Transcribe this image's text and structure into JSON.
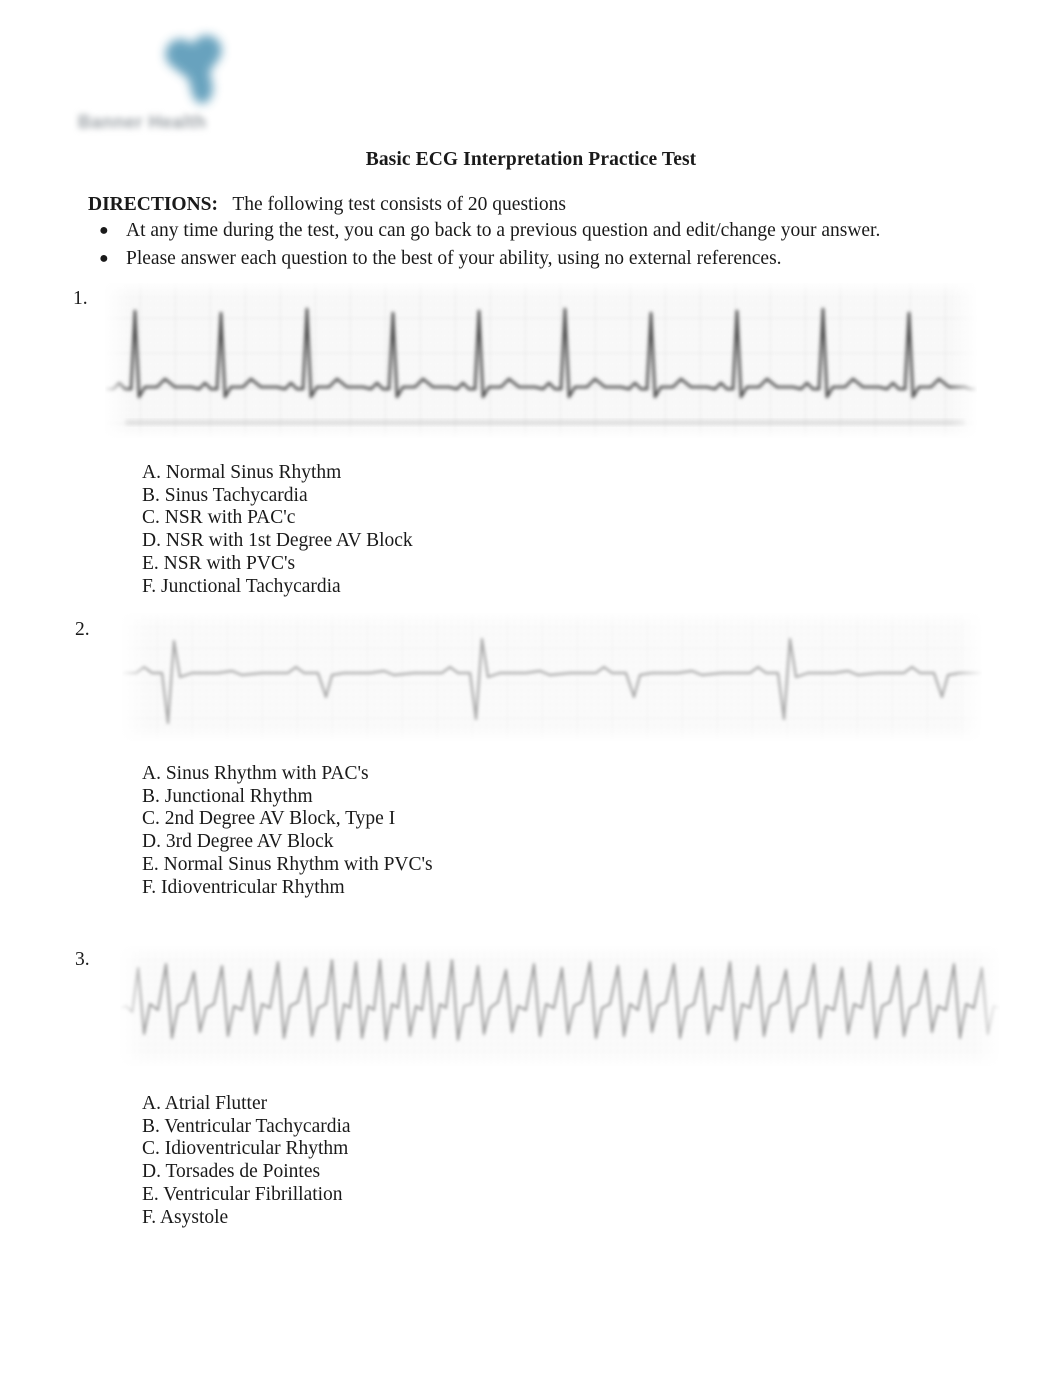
{
  "document": {
    "title": "Basic ECG Interpretation Practice Test"
  },
  "logo": {
    "icon": "heart-icon",
    "wordmark": "Banner Health",
    "heart_color": "#5c9bb9",
    "wordmark_color": "#9aa0a5"
  },
  "directions": {
    "label": "DIRECTIONS:",
    "body": "The following test consists of 20 questions",
    "bullet_glyph": "●",
    "items": [
      "At any time during the test, you can go back to a previous question and edit/change your answer.",
      "Please answer each question to the best of your ability, using no external references."
    ]
  },
  "questions": [
    {
      "number": "1.",
      "strip_alt": "ecg-rhythm-strip-1",
      "options": [
        "A. Normal Sinus Rhythm",
        "B. Sinus Tachycardia",
        "C. NSR with PAC'c",
        "D. NSR with 1st Degree AV Block",
        "E. NSR with PVC's",
        "F. Junctional Tachycardia"
      ]
    },
    {
      "number": "2.",
      "strip_alt": "ecg-rhythm-strip-2",
      "options": [
        "A. Sinus Rhythm with PAC's",
        "B. Junctional Rhythm",
        "C. 2nd Degree AV Block, Type I",
        "D. 3rd Degree AV Block",
        "E. Normal Sinus Rhythm with PVC's",
        "F. Idioventricular Rhythm"
      ]
    },
    {
      "number": "3.",
      "strip_alt": "ecg-rhythm-strip-3",
      "options": [
        "A. Atrial Flutter",
        "B. Ventricular Tachycardia",
        "C. Idioventricular Rhythm",
        "D. Torsades de Pointes",
        "E. Ventricular Fibrillation",
        "F. Asystole"
      ]
    }
  ]
}
